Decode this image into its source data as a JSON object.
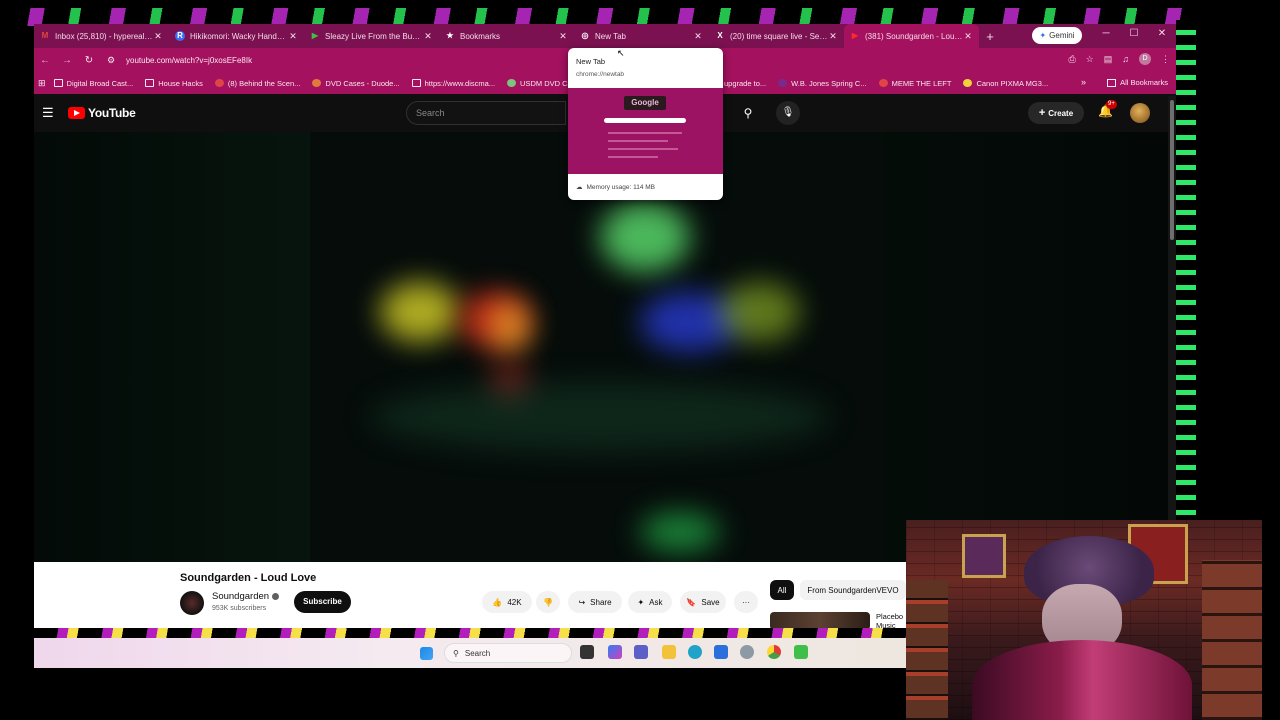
{
  "browser": {
    "tabs": [
      {
        "label": "Inbox (25,810) - hyperealpro",
        "fav_color": "#e2453c",
        "fav_glyph": "M"
      },
      {
        "label": "Hikikomori: Wacky Hands - H",
        "fav_color": "#3b6ef5",
        "fav_glyph": "R"
      },
      {
        "label": "Sleazy Live From the Bunker",
        "fav_color": "#3fbf4a",
        "fav_glyph": "▶"
      },
      {
        "label": "Bookmarks",
        "fav_color": "#7b1150",
        "fav_glyph": "★"
      },
      {
        "label": "New Tab",
        "fav_color": "#7b1150",
        "fav_glyph": "◎"
      },
      {
        "label": "(20) time square live - Searc",
        "fav_color": "#7b1150",
        "fav_glyph": "X"
      },
      {
        "label": "(381) Soundgarden - Loud L",
        "fav_color": "#ff2b2b",
        "fav_glyph": "▶",
        "active": true
      }
    ],
    "new_tab_plus": "+",
    "gemini_label": "Gemini",
    "url": "youtube.com/watch?v=j0xosEFe8Ik",
    "bookmarks": [
      {
        "label": "Digital Broad Cast...",
        "icon": "folder"
      },
      {
        "label": "House Hacks",
        "icon": "folder"
      },
      {
        "label": "(8) Behind the Scen...",
        "icon": "dot"
      },
      {
        "label": "DVD Cases - Duode...",
        "icon": "dot"
      },
      {
        "label": "https://www.discma...",
        "icon": "folder"
      },
      {
        "label": "USDM DVD Case",
        "icon": "dot"
      }
    ],
    "bookmarks_right": [
      {
        "label": "upgrade to...",
        "icon": "folder"
      },
      {
        "label": "W.B. Jones Spring C...",
        "icon": "dot"
      },
      {
        "label": "MEME THE LEFT",
        "icon": "dot"
      },
      {
        "label": "Canon PIXMA MG3...",
        "icon": "dot"
      }
    ],
    "overflow_chevron": "»",
    "all_bookmarks": "All Bookmarks",
    "profile_letter": "D"
  },
  "hovercard": {
    "title": "New Tab",
    "url": "chrome://newtab",
    "logo_text": "Google",
    "memory": "Memory usage: 114 MB"
  },
  "youtube": {
    "brand": "YouTube",
    "search_placeholder": "Search",
    "create_label": "Create",
    "notif_badge": "9+",
    "video_title": "Soundgarden - Loud Love",
    "channel": "Soundgarden",
    "subscribers": "953K subscribers",
    "subscribe_label": "Subscribe",
    "likes": "42K",
    "share_label": "Share",
    "ask_label": "Ask",
    "save_label": "Save",
    "more_label": "···",
    "chip_all": "All",
    "chip_from": "From SoundgardenVEVO",
    "next_title": "Placebo Music"
  },
  "taskbar": {
    "search_placeholder": "Search"
  },
  "colors": {
    "tabbar": "#7b1150",
    "toolbar": "#a3115f",
    "yt_red": "#ff0000"
  }
}
